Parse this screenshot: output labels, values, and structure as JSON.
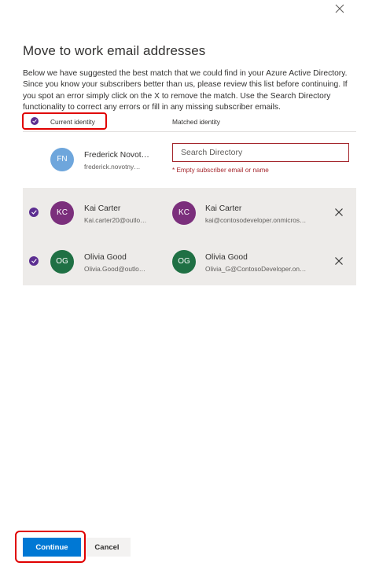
{
  "dialog": {
    "title": "Move to work email addresses",
    "description": "Below we have suggested the best match that we could find in your Azure Active Directory. Since you know your subscribers better than us, please review this list before continuing. If you spot an error simply click on the X to remove the match. Use the Search Directory functionality to correct any errors or fill in any missing subscriber emails.",
    "close_icon": "close-icon"
  },
  "table": {
    "header_current": "Current identity",
    "header_matched": "Matched identity"
  },
  "rows": [
    {
      "selected": false,
      "current": {
        "initials": "FN",
        "name": "Frederick Novot…",
        "email": "frederick.novotny…",
        "avatar_color": "#6ea6dc"
      },
      "search_placeholder": "Search Directory",
      "error": "* Empty subscriber email or name"
    },
    {
      "selected": true,
      "current": {
        "initials": "KC",
        "name": "Kai Carter",
        "email": "Kai.carter20@outlo…",
        "avatar_color": "#7b2f7c"
      },
      "matched": {
        "initials": "KC",
        "name": "Kai Carter",
        "email": "kai@contosodeveloper.onmicros…",
        "avatar_color": "#7b2f7c"
      }
    },
    {
      "selected": true,
      "current": {
        "initials": "OG",
        "name": "Olivia Good",
        "email": "Olivia.Good@outlo…",
        "avatar_color": "#1f7044"
      },
      "matched": {
        "initials": "OG",
        "name": "Olivia Good",
        "email": "Olivia_G@ContosoDeveloper.on…",
        "avatar_color": "#1f7044"
      }
    }
  ],
  "footer": {
    "continue_label": "Continue",
    "cancel_label": "Cancel"
  },
  "colors": {
    "accent": "#0078d4",
    "check": "#5c2e91",
    "error": "#a4262c",
    "highlight_box": "#e00000"
  }
}
